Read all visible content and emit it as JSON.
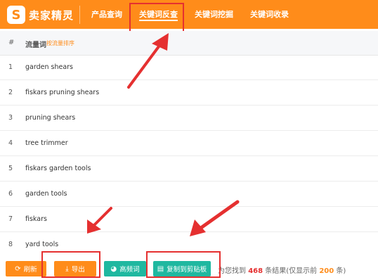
{
  "app": {
    "logo_glyph": "S",
    "logo_text": "卖家精灵"
  },
  "nav": [
    {
      "label": "产品查询",
      "active": false
    },
    {
      "label": "关键词反查",
      "active": true
    },
    {
      "label": "关键词挖掘",
      "active": false
    },
    {
      "label": "关键词收录",
      "active": false
    }
  ],
  "table": {
    "header": {
      "num": "#",
      "keyword": "流量词",
      "sort_hint": "按流量排序"
    },
    "rows": [
      {
        "num": "1",
        "keyword": "garden shears"
      },
      {
        "num": "2",
        "keyword": "fiskars pruning shears"
      },
      {
        "num": "3",
        "keyword": "pruning shears"
      },
      {
        "num": "4",
        "keyword": "tree trimmer"
      },
      {
        "num": "5",
        "keyword": "fiskars garden tools"
      },
      {
        "num": "6",
        "keyword": "garden tools"
      },
      {
        "num": "7",
        "keyword": "fiskars"
      },
      {
        "num": "8",
        "keyword": "yard tools"
      }
    ]
  },
  "toolbar": {
    "refresh_label": "刷新",
    "export_label": "导出",
    "high_freq_label": "高频词",
    "copy_label": "复制到剪贴板"
  },
  "result": {
    "prefix": "为您找到",
    "count": "468",
    "mid": "条结果(仅显示前",
    "shown": "200",
    "suffix": "条)"
  },
  "colors": {
    "brand": "#ff8c1a",
    "teal": "#1fb8a0",
    "annotation_red": "#e53030"
  }
}
